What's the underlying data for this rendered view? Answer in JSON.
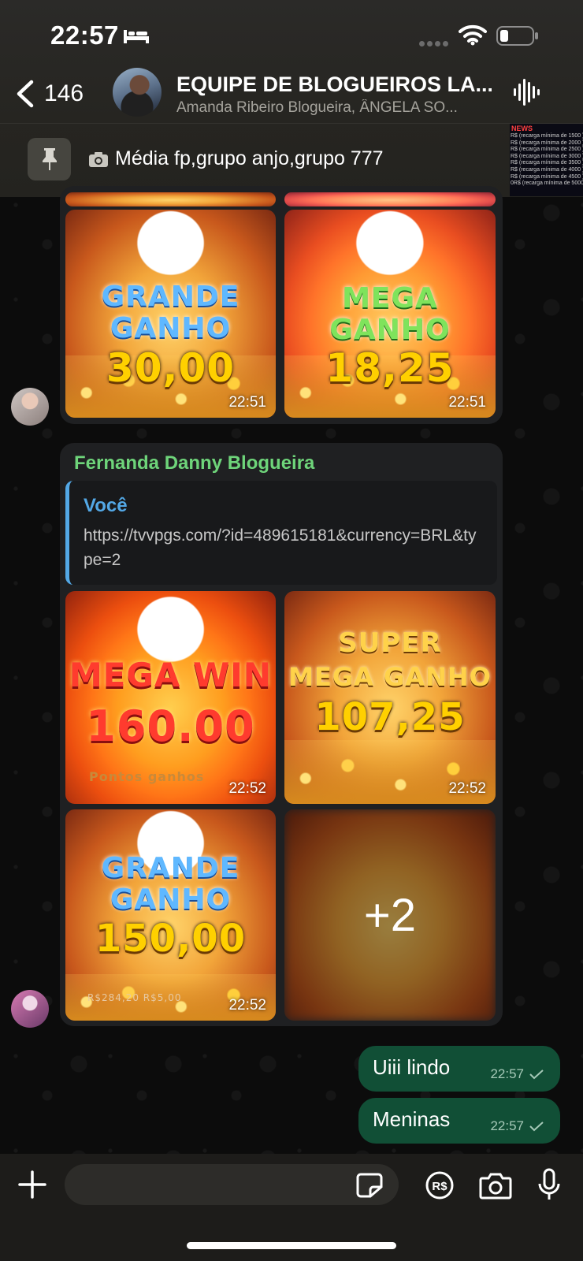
{
  "status": {
    "time": "22:57"
  },
  "header": {
    "back_count": "146",
    "title": "EQUIPE DE BLOGUEIROS LA...",
    "subtitle": "Amanda Ribeiro Blogueira, ÂNGELA SO..."
  },
  "pinned": {
    "text": "Média fp,grupo anjo,grupo 777",
    "thumb_title": "NEWS",
    "thumb_lines": [
      "R$ (recarga mínima de 1500 )",
      "R$ (recarga mínima de 2000 )",
      "R$ (recarga mínima de 2500 )",
      "R$ (recarga mínima de 3000 )",
      "R$ (recarga mínima de 3500 )",
      "R$ (recarga mínima de 4000 )",
      "R$ (recarga mínima de 4500 )",
      "0R$ (recarga mínima de 5000"
    ]
  },
  "messages": {
    "album1": [
      {
        "line1": "GRANDE",
        "line2": "GANHO",
        "amount": "30,00",
        "time": "22:51"
      },
      {
        "line1": "MEGA",
        "line2": "GANHO",
        "amount": "18,25",
        "time": "22:51"
      }
    ],
    "reply": {
      "sender": "Fernanda Danny Blogueira",
      "quote_name": "Você",
      "quote_text": "https://tvvpgs.com/?id=489615181&currency=BRL&type=2"
    },
    "album2": [
      {
        "line1": "MEGA WIN",
        "amount": "160.00",
        "time": "22:52",
        "footer": "Pontos ganhos"
      },
      {
        "line1": "SUPER",
        "line2": "MEGA GANHO",
        "amount": "107,25",
        "time": "22:52"
      },
      {
        "line1": "GRANDE",
        "line2": "GANHO",
        "amount": "150,00",
        "time": "22:52",
        "footer": "R$284,20   R$5,00"
      },
      {
        "more": "+2"
      }
    ],
    "outgoing": [
      {
        "text": "Uiii lindo",
        "time": "22:57"
      },
      {
        "text": "Meninas",
        "time": "22:57"
      }
    ]
  },
  "icons": {
    "status": [
      "bed-icon",
      "wifi-icon",
      "battery-icon"
    ],
    "header": [
      "chevron-left-icon",
      "audio-wave-icon"
    ],
    "pin": [
      "pin-icon",
      "camera-icon"
    ],
    "composer": [
      "plus-icon",
      "sticker-icon",
      "pix-icon",
      "camera-icon",
      "mic-icon"
    ]
  },
  "colors": {
    "sender_name": "#6ed47a",
    "quote_name": "#53a8e6",
    "outgoing_bubble": "#114f36",
    "incoming_bubble": "#1f2022"
  }
}
